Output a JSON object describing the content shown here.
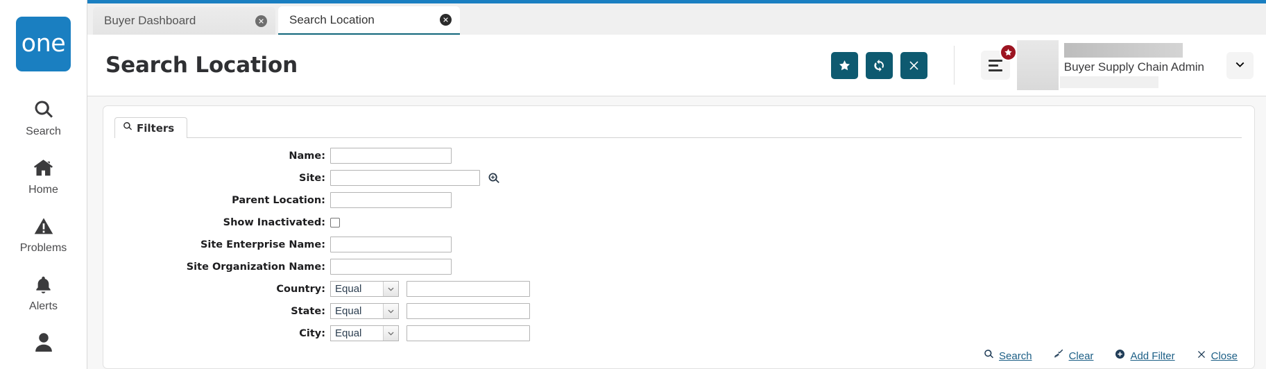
{
  "brand": {
    "logo_text": "one",
    "logo_color": "#1a7fc1",
    "accent_teal": "#0e5a70",
    "badge_red": "#9c1421",
    "link_blue": "#1b5e85"
  },
  "sidebar": {
    "items": [
      {
        "label": "Search",
        "icon": "search-icon"
      },
      {
        "label": "Home",
        "icon": "home-icon"
      },
      {
        "label": "Problems",
        "icon": "warning-triangle-icon"
      },
      {
        "label": "Alerts",
        "icon": "bell-icon"
      }
    ]
  },
  "tabs": [
    {
      "label": "Buyer Dashboard",
      "active": false
    },
    {
      "label": "Search Location",
      "active": true
    }
  ],
  "header": {
    "title": "Search Location",
    "buttons": [
      {
        "name": "favorite-button",
        "icon": "star-icon"
      },
      {
        "name": "refresh-button",
        "icon": "refresh-icon"
      },
      {
        "name": "close-page-button",
        "icon": "x-icon"
      }
    ],
    "menu": {
      "name": "hamburger-menu-button",
      "badge_icon": "star-icon"
    },
    "user": {
      "name": "Buyer Supply Chain Admin",
      "caret": "chevron-down-icon"
    }
  },
  "filters": {
    "tab_label": "Filters",
    "tab_icon": "search-icon",
    "fields": [
      {
        "label": "Name:",
        "type": "text",
        "value": "",
        "placeholder": "",
        "name": "name-field"
      },
      {
        "label": "Site:",
        "type": "text-lookup",
        "value": "",
        "placeholder": "",
        "name": "site-field",
        "lookup_icon": "zoom-in-icon"
      },
      {
        "label": "Parent Location:",
        "type": "text",
        "value": "",
        "placeholder": "",
        "name": "parent-location-field"
      },
      {
        "label": "Show Inactivated:",
        "type": "checkbox",
        "checked": false,
        "name": "show-inactivated-checkbox"
      },
      {
        "label": "Site Enterprise Name:",
        "type": "text",
        "value": "",
        "placeholder": "",
        "name": "site-enterprise-name-field"
      },
      {
        "label": "Site Organization Name:",
        "type": "text",
        "value": "",
        "placeholder": "",
        "name": "site-organization-name-field"
      },
      {
        "label": "Country:",
        "type": "operator-text",
        "operator": "Equal",
        "value": "",
        "placeholder": "",
        "name": "country-field"
      },
      {
        "label": "State:",
        "type": "operator-text",
        "operator": "Equal",
        "value": "",
        "placeholder": "",
        "name": "state-field"
      },
      {
        "label": "City:",
        "type": "operator-text",
        "operator": "Equal",
        "value": "",
        "placeholder": "",
        "name": "city-field"
      }
    ]
  },
  "actions": [
    {
      "label": "Search",
      "icon": "search-icon",
      "name": "search-action"
    },
    {
      "label": "Clear",
      "icon": "broom-icon",
      "name": "clear-action"
    },
    {
      "label": "Add Filter",
      "icon": "plus-circle-icon",
      "name": "add-filter-action"
    },
    {
      "label": "Close",
      "icon": "x-icon",
      "name": "close-action"
    }
  ]
}
